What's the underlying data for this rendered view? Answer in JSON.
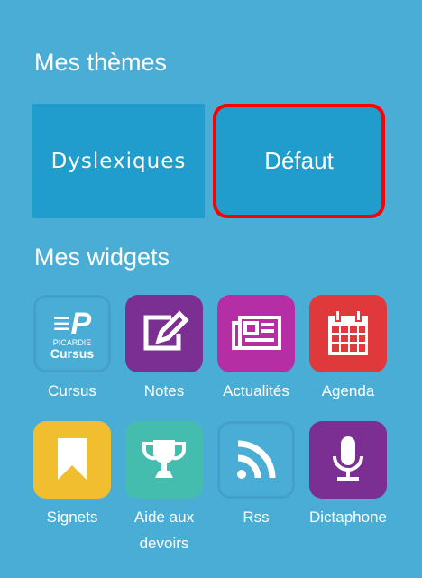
{
  "themes": {
    "title": "Mes thèmes",
    "items": [
      {
        "label": "Dyslexiques"
      },
      {
        "label": "Défaut",
        "selected": true
      }
    ]
  },
  "widgets": {
    "title": "Mes widgets",
    "items": [
      {
        "label": "Cursus",
        "icon": "picardie-cursus-logo",
        "logo_text": "PICARDIE",
        "logo_text2": "Cursus"
      },
      {
        "label": "Notes",
        "icon": "pencil-edit-icon",
        "color": "#7b2f92"
      },
      {
        "label": "Actualités",
        "icon": "newspaper-icon",
        "color": "#b52ea3"
      },
      {
        "label": "Agenda",
        "icon": "calendar-icon",
        "color": "#e0393b"
      },
      {
        "label": "Signets",
        "icon": "bookmark-icon",
        "color": "#f0be2e"
      },
      {
        "label": "Aide aux devoirs",
        "icon": "trophy-icon",
        "color": "#45bdae"
      },
      {
        "label": "Rss",
        "icon": "rss-icon"
      },
      {
        "label": "Dictaphone",
        "icon": "microphone-icon",
        "color": "#7b2f92"
      }
    ]
  }
}
